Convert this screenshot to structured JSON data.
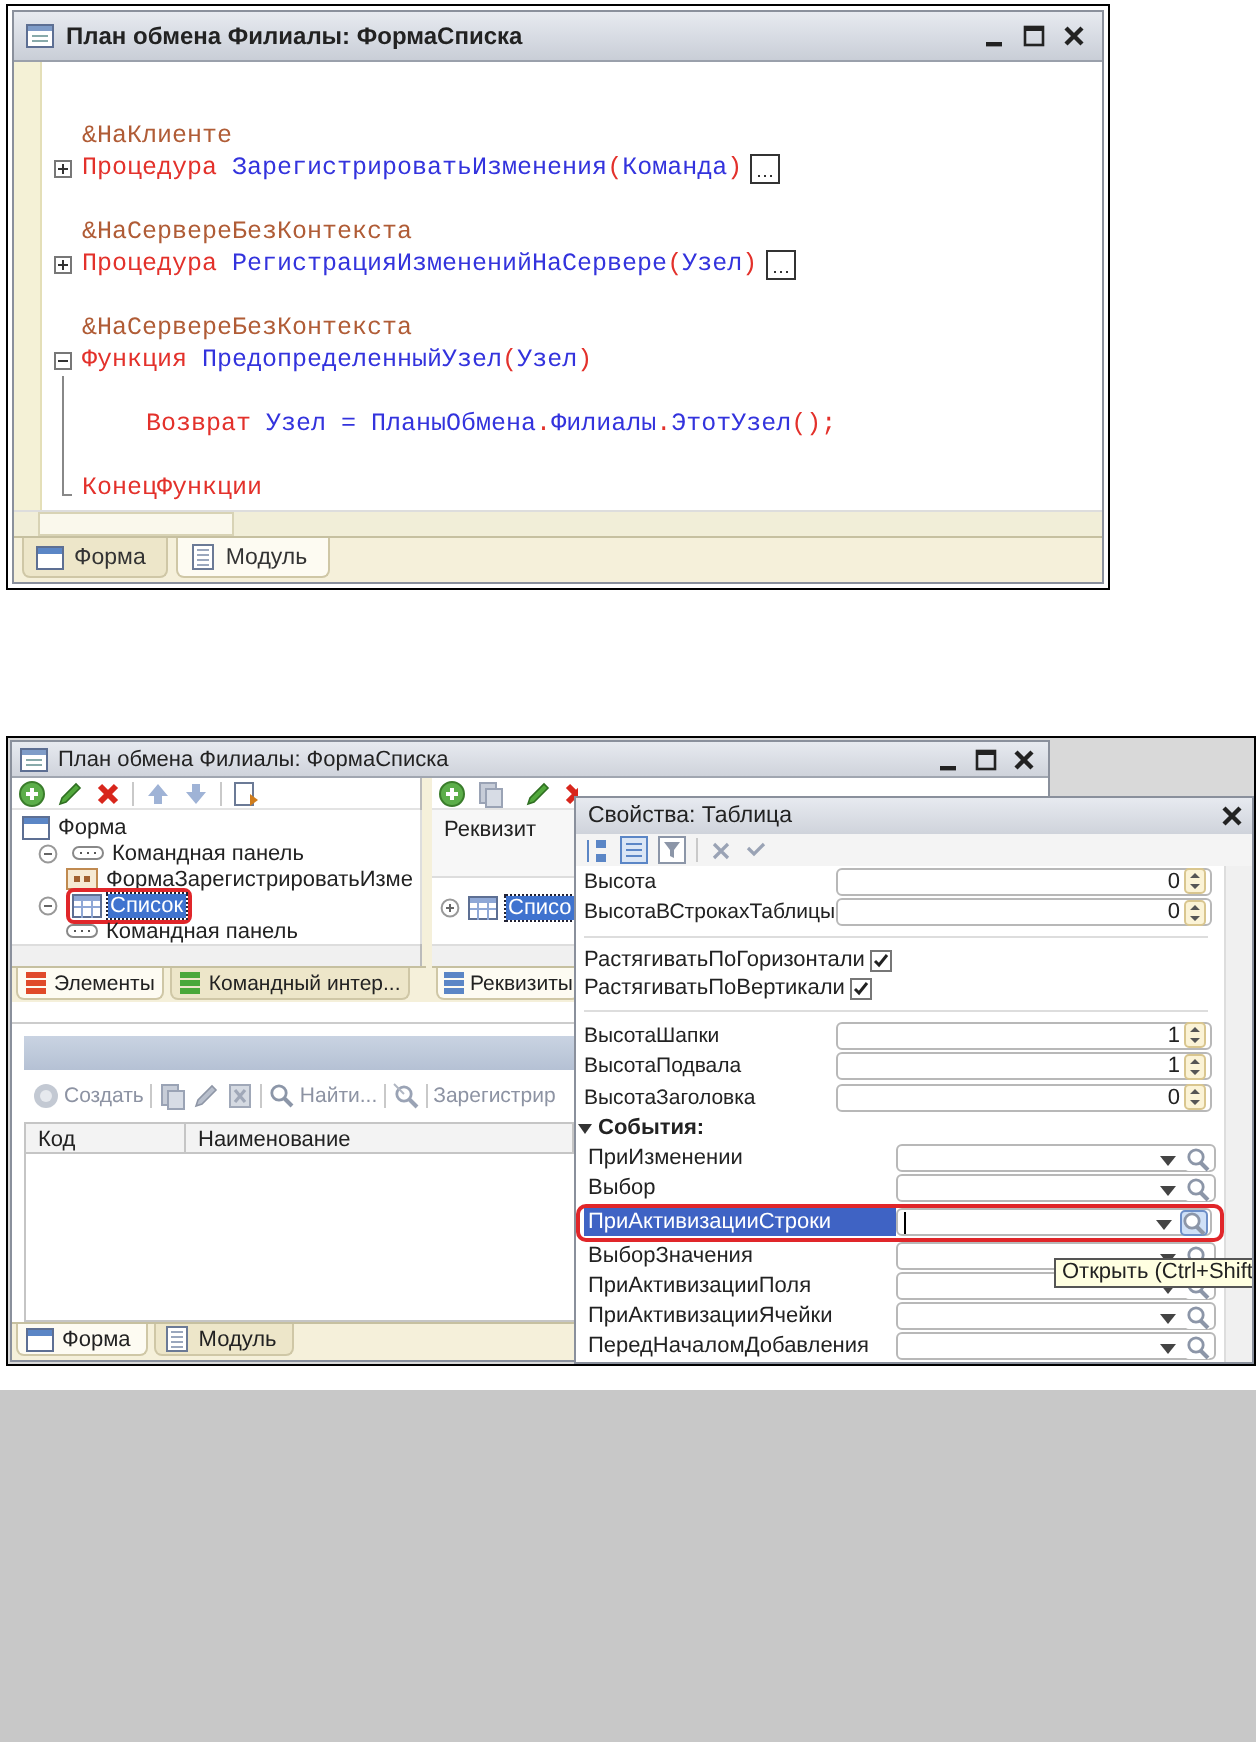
{
  "module_window": {
    "title": "План обмена Филиалы: ФормаСписка",
    "lines": [
      {
        "kind": "blank"
      },
      {
        "kind": "directive",
        "tokens": [
          {
            "kind": "directive",
            "text": "&НаКлиенте"
          }
        ]
      },
      {
        "kind": "procedure",
        "collapsed": true,
        "tokens": [
          {
            "kind": "keyword",
            "text": "Процедура"
          },
          {
            "kind": "name",
            "text": " ЗарегистрироватьИзменения"
          },
          {
            "kind": "punct",
            "text": "("
          },
          {
            "kind": "name",
            "text": "Команда"
          },
          {
            "kind": "punct",
            "text": ")"
          }
        ]
      },
      {
        "kind": "blank"
      },
      {
        "kind": "directive",
        "tokens": [
          {
            "kind": "directive",
            "text": "&НаСервереБезКонтекста"
          }
        ]
      },
      {
        "kind": "procedure",
        "collapsed": true,
        "tokens": [
          {
            "kind": "keyword",
            "text": "Процедура"
          },
          {
            "kind": "name",
            "text": " РегистрацияИзмененийНаСервере"
          },
          {
            "kind": "punct",
            "text": "("
          },
          {
            "kind": "name",
            "text": "Узел"
          },
          {
            "kind": "punct",
            "text": ")"
          }
        ]
      },
      {
        "kind": "blank"
      },
      {
        "kind": "directive",
        "tokens": [
          {
            "kind": "directive",
            "text": "&НаСервереБезКонтекста"
          }
        ]
      },
      {
        "kind": "function",
        "collapsed": false,
        "tokens": [
          {
            "kind": "keyword",
            "text": "Функция"
          },
          {
            "kind": "name",
            "text": " ПредопределенныйУзел"
          },
          {
            "kind": "punct",
            "text": "("
          },
          {
            "kind": "name",
            "text": "Узел"
          },
          {
            "kind": "punct",
            "text": ")"
          }
        ]
      },
      {
        "kind": "blank"
      },
      {
        "kind": "body",
        "tokens": [
          {
            "kind": "keyword",
            "text": "Возврат"
          },
          {
            "kind": "name",
            "text": " Узел = ПланыОбмена"
          },
          {
            "kind": "punct",
            "text": "."
          },
          {
            "kind": "name",
            "text": "Филиалы"
          },
          {
            "kind": "punct",
            "text": "."
          },
          {
            "kind": "name",
            "text": "ЭтотУзел"
          },
          {
            "kind": "punct",
            "text": "();"
          }
        ]
      },
      {
        "kind": "blank"
      },
      {
        "kind": "end",
        "tokens": [
          {
            "kind": "keyword",
            "text": "КонецФункции"
          }
        ]
      }
    ],
    "tabs": [
      {
        "label": "Форма",
        "kind": "form",
        "selected": false
      },
      {
        "label": "Модуль",
        "kind": "module",
        "selected": true
      }
    ]
  },
  "form_editor": {
    "title": "План обмена Филиалы: ФормаСписка",
    "elements_tree": [
      {
        "label": "Форма",
        "kind": "form",
        "selected": false,
        "highlighted": false,
        "children": [
          {
            "label": "Командная панель",
            "kind": "panel",
            "expanded": true,
            "selected": false,
            "highlighted": false,
            "children": [
              {
                "label": "ФормаЗарегистрироватьИзме",
                "kind": "button",
                "selected": false,
                "highlighted": false
              }
            ]
          },
          {
            "label": "Список",
            "kind": "table",
            "expanded": true,
            "selected": true,
            "highlighted": true,
            "children": [
              {
                "label": "Командная панель",
                "kind": "panel",
                "selected": false,
                "highlighted": false
              }
            ]
          }
        ]
      }
    ],
    "left_tabs": [
      {
        "label": "Элементы",
        "kind": "elements",
        "selected": true
      },
      {
        "label": "Командный интер...",
        "kind": "commands",
        "selected": false
      }
    ],
    "attributes": {
      "column": "Реквизит",
      "items": [
        {
          "label": "Списо",
          "expanded": false,
          "selected": true
        }
      ],
      "tab": "Реквизиты"
    },
    "preview": {
      "toolbar": [
        {
          "kind": "create",
          "label": "Создать"
        },
        {
          "kind": "copy"
        },
        {
          "kind": "edit"
        },
        {
          "kind": "delete"
        },
        {
          "kind": "find",
          "label": "Найти..."
        },
        {
          "kind": "cancel-find"
        },
        {
          "kind": "text",
          "label": "Зарегистрир"
        }
      ],
      "columns": [
        "Код",
        "Наименование"
      ]
    },
    "bottom_tabs": [
      {
        "label": "Форма",
        "kind": "form",
        "selected": true
      },
      {
        "label": "Модуль",
        "kind": "module",
        "selected": false
      }
    ]
  },
  "properties": {
    "title": "Свойства: Таблица",
    "rows": [
      {
        "kind": "number",
        "label": "Высота",
        "value": "0"
      },
      {
        "kind": "number",
        "label": "ВысотаВСтрокахТаблицы",
        "value": "0"
      },
      {
        "kind": "divider"
      },
      {
        "kind": "checkbox",
        "label": "РастягиватьПоГоризонтали",
        "checked": true
      },
      {
        "kind": "checkbox",
        "label": "РастягиватьПоВертикали",
        "checked": true
      },
      {
        "kind": "divider"
      },
      {
        "kind": "number",
        "label": "ВысотаШапки",
        "value": "1"
      },
      {
        "kind": "number",
        "label": "ВысотаПодвала",
        "value": "1"
      },
      {
        "kind": "number",
        "label": "ВысотаЗаголовка",
        "value": "0"
      },
      {
        "kind": "section",
        "label": "События:",
        "expanded": true
      },
      {
        "kind": "event",
        "label": "ПриИзменении",
        "selected": false,
        "highlighted": false
      },
      {
        "kind": "event",
        "label": "Выбор",
        "selected": false,
        "highlighted": false
      },
      {
        "kind": "event",
        "label": "ПриАктивизацииСтроки",
        "selected": true,
        "highlighted": true
      },
      {
        "kind": "event",
        "label": "ВыборЗначения",
        "selected": false,
        "highlighted": false
      },
      {
        "kind": "event",
        "label": "ПриАктивизацииПоля",
        "selected": false,
        "highlighted": false
      },
      {
        "kind": "event",
        "label": "ПриАктивизацииЯчейки",
        "selected": false,
        "highlighted": false
      },
      {
        "kind": "event",
        "label": "ПередНачаломДобавления",
        "selected": false,
        "highlighted": false
      }
    ],
    "tooltip": "Открыть (Ctrl+Shift"
  }
}
